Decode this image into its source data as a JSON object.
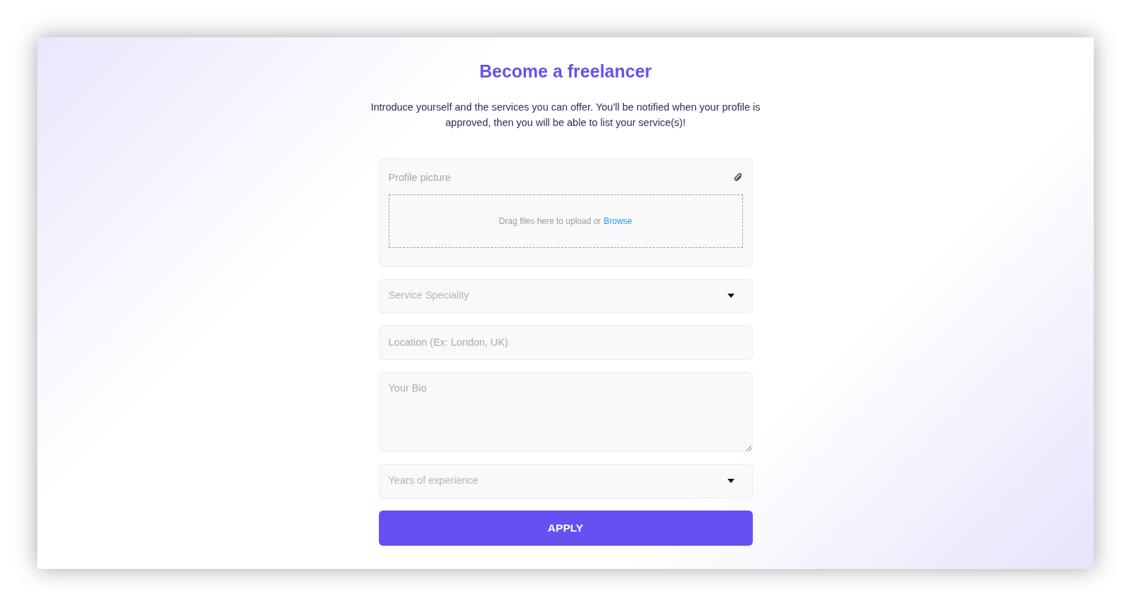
{
  "title": "Become a freelancer",
  "intro": "Introduce yourself and the services you can offer. You'll be notified when your profile is approved, then you will be able to list your service(s)!",
  "fields": [
    {
      "kind": "file",
      "label": "Profile picture",
      "drop_text": "Drag files here to upload or",
      "browse_link": "Browse"
    },
    {
      "kind": "select",
      "placeholder": "Service Speciality"
    },
    {
      "kind": "text",
      "placeholder": "Location (Ex: London, UK)"
    },
    {
      "kind": "textarea",
      "placeholder": "Your Bio"
    },
    {
      "kind": "select",
      "placeholder": "Years of experience"
    }
  ],
  "submit_button": "APPLY"
}
